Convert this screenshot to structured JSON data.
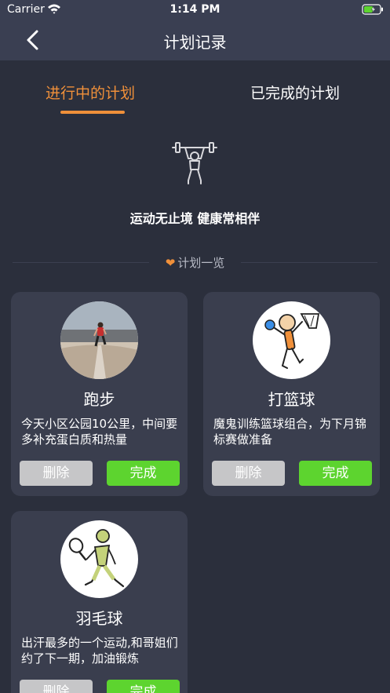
{
  "status": {
    "carrier": "Carrier",
    "time": "1:14 PM"
  },
  "nav": {
    "title": "计划记录",
    "back_icon": "chevron-left-icon"
  },
  "tabs": [
    {
      "label": "进行中的计划",
      "active": true
    },
    {
      "label": "已完成的计划",
      "active": false
    }
  ],
  "hero": {
    "icon": "weightlifting-icon",
    "slogan": "运动无止境 健康常相伴"
  },
  "section": {
    "title": "计划一览",
    "icon": "heart-icon"
  },
  "colors": {
    "accent": "#f0903a",
    "done": "#5dd42f",
    "delete": "#c6c6c8",
    "card": "#3a3e4e",
    "background": "#2b2f3c"
  },
  "plans": [
    {
      "title": "跑步",
      "description": "今天小区公园10公里，中间要多补充蛋白质和热量",
      "delete_label": "删除",
      "done_label": "完成",
      "image": "runner-photo"
    },
    {
      "title": "打篮球",
      "description": "魔鬼训练篮球组合，为下月锦标赛做准备",
      "delete_label": "删除",
      "done_label": "完成",
      "image": "basketball-player-icon"
    },
    {
      "title": "羽毛球",
      "description": "出汗最多的一个运动,和哥姐们约了下一期，加油锻炼",
      "delete_label": "删除",
      "done_label": "完成",
      "image": "badminton-player-icon"
    }
  ]
}
